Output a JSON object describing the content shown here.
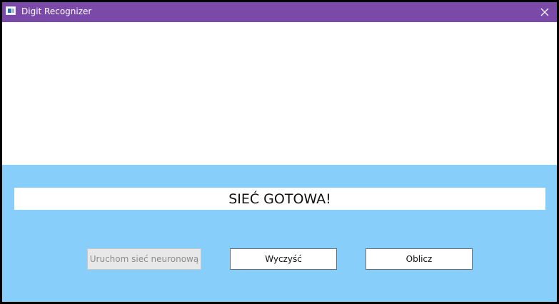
{
  "window": {
    "title": "Digit Recognizer",
    "title_bar_color": "#7b4aa8",
    "background_color": "#87cefa"
  },
  "icons": {
    "app": "app-window-icon",
    "close": "close-icon"
  },
  "canvas": {
    "background": "#ffffff"
  },
  "status": {
    "text": "SIEĆ GOTOWA!"
  },
  "buttons": {
    "start_label": "Uruchom sieć neuronową",
    "start_enabled": false,
    "clear_label": "Wyczyść",
    "compute_label": "Oblicz"
  }
}
